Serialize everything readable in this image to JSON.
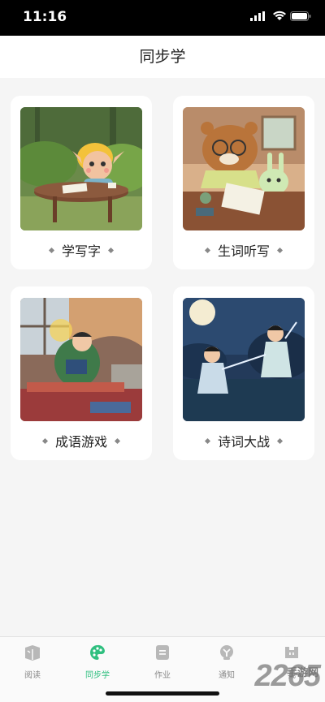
{
  "status": {
    "time": "11:16"
  },
  "nav": {
    "title": "同步学"
  },
  "cards": [
    {
      "label": "学写字"
    },
    {
      "label": "生词听写"
    },
    {
      "label": "成语游戏"
    },
    {
      "label": "诗词大战"
    }
  ],
  "tabs": [
    {
      "label": "阅读",
      "icon": "book-icon"
    },
    {
      "label": "同步学",
      "icon": "palette-icon"
    },
    {
      "label": "作业",
      "icon": "homework-icon"
    },
    {
      "label": "通知",
      "icon": "bell-icon"
    },
    {
      "label": "我",
      "icon": "profile-icon"
    }
  ],
  "watermark": {
    "number": "2265",
    "suffix": "手游网"
  },
  "colors": {
    "accent": "#2fbf7f",
    "tab_inactive": "#888888",
    "background": "#f5f5f5"
  }
}
